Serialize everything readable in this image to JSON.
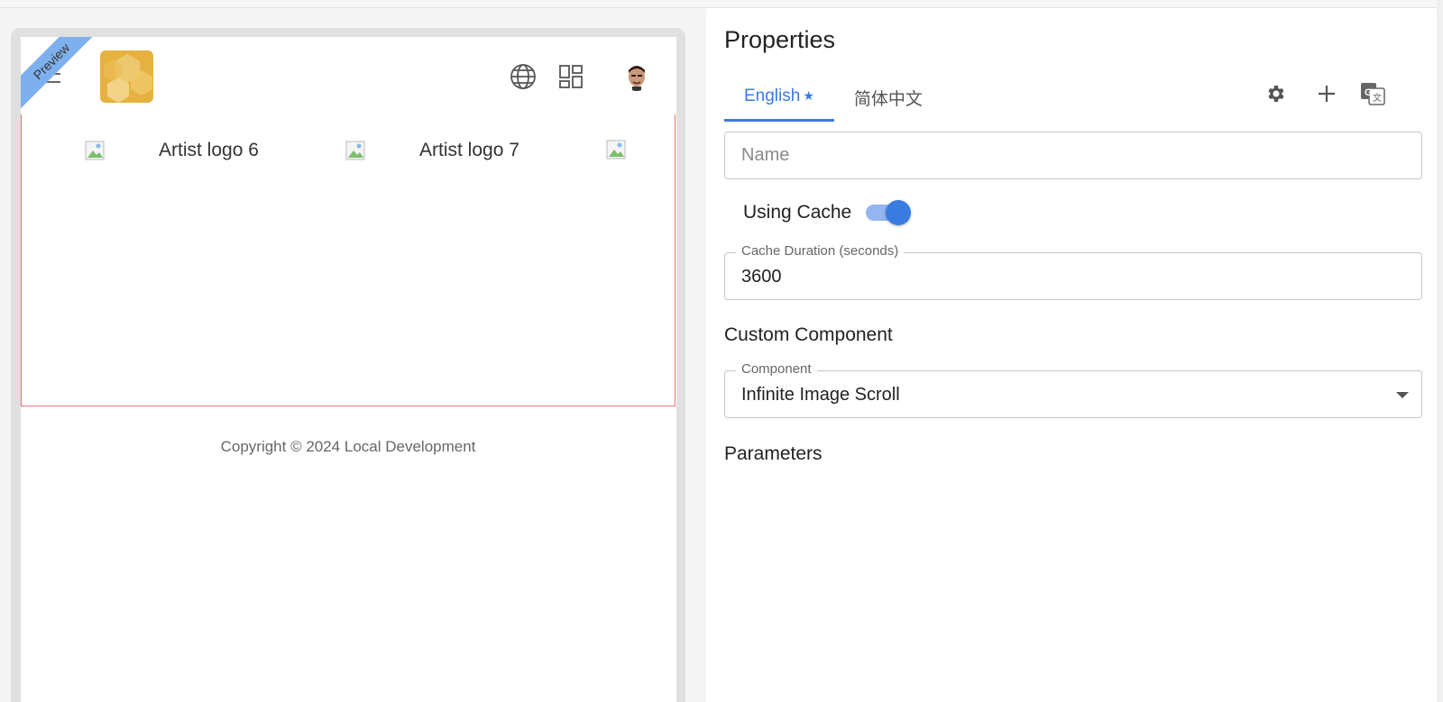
{
  "preview": {
    "ribbon": "Preview",
    "images": [
      {
        "alt": "Artist logo 6"
      },
      {
        "alt": "Artist logo 7"
      },
      {
        "alt": ""
      }
    ],
    "footer": "Copyright © 2024 Local Development"
  },
  "properties": {
    "title": "Properties",
    "tabs": [
      {
        "label": "English",
        "marker": "★",
        "active": true
      },
      {
        "label": "简体中文",
        "active": false
      }
    ],
    "name_placeholder": "Name",
    "using_cache_label": "Using Cache",
    "using_cache_on": true,
    "cache_duration_label": "Cache Duration (seconds)",
    "cache_duration_value": "3600",
    "custom_component_heading": "Custom Component",
    "component_label": "Component",
    "component_value": "Infinite Image Scroll",
    "parameters_heading": "Parameters"
  },
  "colors": {
    "accent": "#3a7be0",
    "logo": "#e6b23f",
    "ribbon": "#7fb0ee",
    "scroll_border": "#e57373"
  },
  "icons": [
    "menu-icon",
    "globe-icon",
    "grid-icon",
    "gear-icon",
    "plus-icon",
    "translate-icon",
    "broken-image-icon",
    "dropdown-arrow-icon"
  ]
}
